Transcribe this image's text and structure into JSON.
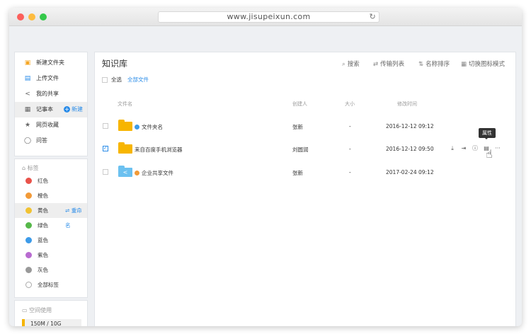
{
  "browser": {
    "url": "www.jisupeixun.com"
  },
  "nav": {
    "items": [
      {
        "label": "新建文件夹",
        "icon": "new-folder-icon"
      },
      {
        "label": "上传文件",
        "icon": "upload-icon"
      },
      {
        "label": "我的共享",
        "icon": "share-icon"
      },
      {
        "label": "记事本",
        "icon": "notebook-icon",
        "action": "新建"
      },
      {
        "label": "网页收藏",
        "icon": "star-icon"
      },
      {
        "label": "问答",
        "icon": "qa-icon"
      }
    ]
  },
  "tags": {
    "title": "标签",
    "items": [
      {
        "label": "红色",
        "color": "#e9524a"
      },
      {
        "label": "橙色",
        "color": "#f29a38"
      },
      {
        "label": "黄色",
        "color": "#f1c232",
        "action": "重命名"
      },
      {
        "label": "绿色",
        "color": "#56b84a"
      },
      {
        "label": "蓝色",
        "color": "#3d9be9"
      },
      {
        "label": "紫色",
        "color": "#b86bd0"
      },
      {
        "label": "灰色",
        "color": "#999999"
      },
      {
        "label": "全部标签",
        "color": ""
      }
    ]
  },
  "space": {
    "title": "空间使用",
    "usage": "150M / 10G",
    "fraction": 0.015
  },
  "main": {
    "title": "知识库",
    "toolbar": {
      "search": "搜索",
      "transfer": "传输列表",
      "sort": "名称排序",
      "view": "切换图标模式"
    },
    "select_all": "全选",
    "breadcrumb": "全部文件",
    "columns": {
      "name": "文件名",
      "creator": "创建人",
      "size": "大小",
      "modified": "修改时间"
    },
    "rows": [
      {
        "name": "文件夹名",
        "creator": "张新",
        "size": "-",
        "modified": "2016-12-12 09:12",
        "dot": "#3d9be9",
        "folder": "#f7b500",
        "checked": false
      },
      {
        "name": "来自百度手机浏览器",
        "creator": "刘圆润",
        "size": "-",
        "modified": "2016-12-12 09:50",
        "dot": "",
        "folder": "#f7b500",
        "checked": true
      },
      {
        "name": "企业共享文件",
        "creator": "张新",
        "size": "-",
        "modified": "2017-02-24 09:12",
        "dot": "#f29a38",
        "folder": "#6cc1f0",
        "checked": false
      }
    ],
    "tooltip": "属性"
  }
}
